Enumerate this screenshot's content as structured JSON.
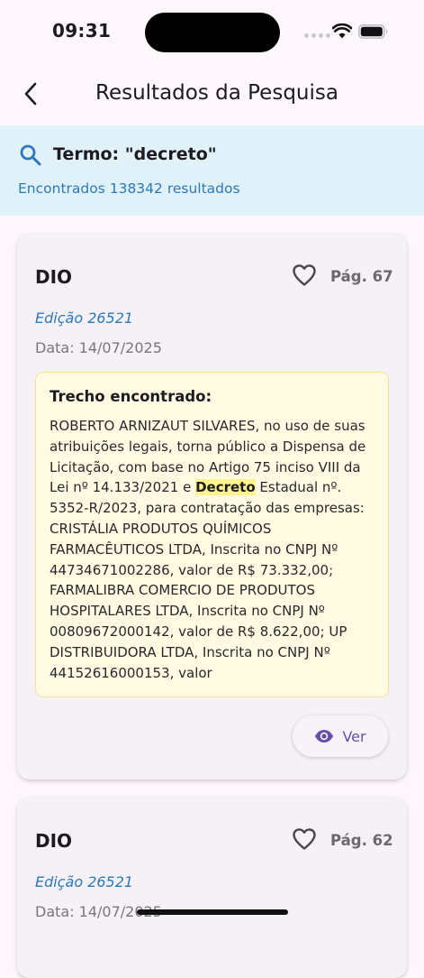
{
  "status_bar": {
    "time": "09:31"
  },
  "app_bar": {
    "title": "Resultados da Pesquisa"
  },
  "search": {
    "term_label": "Termo: \"decreto\"",
    "count_label": "Encontrados 138342 resultados"
  },
  "results": [
    {
      "source": "DIO",
      "page": "Pág. 67",
      "edition": "Edição 26521",
      "date": "Data: 14/07/2025",
      "excerpt_title": "Trecho encontrado:",
      "excerpt_before": "ROBERTO ARNIZAUT SILVARES, no uso de suas atribuições legais, torna público a Dispensa de Licitação, com base no Artigo 75 inciso VIII da Lei nº 14.133/2021 e ",
      "excerpt_highlight": "Decreto",
      "excerpt_after": " Estadual nº. 5352-R/2023, para contratação das empresas: CRISTÁLIA PRODUTOS QUÍMICOS FARMACÊUTICOS LTDA, Inscrita no CNPJ Nº 44734671002286, valor de R$ 73.332,00; FARMALIBRA COMERCIO DE PRODUTOS HOSPITALARES LTDA, Inscrita no CNPJ Nº 00809672000142, valor de R$ 8.622,00; UP DISTRIBUIDORA LTDA, Inscrita no CNPJ Nº 44152616000153, valor",
      "view_label": "Ver"
    },
    {
      "source": "DIO",
      "page": "Pág. 62",
      "edition": "Edição 26521",
      "date": "Data: 14/07/2025"
    }
  ],
  "colors": {
    "accent_blue": "#2b79b8",
    "primary_purple": "#6750a4",
    "banner_bg": "#e1f1fa",
    "excerpt_bg": "#fffbe3",
    "highlight": "#fff38c"
  }
}
